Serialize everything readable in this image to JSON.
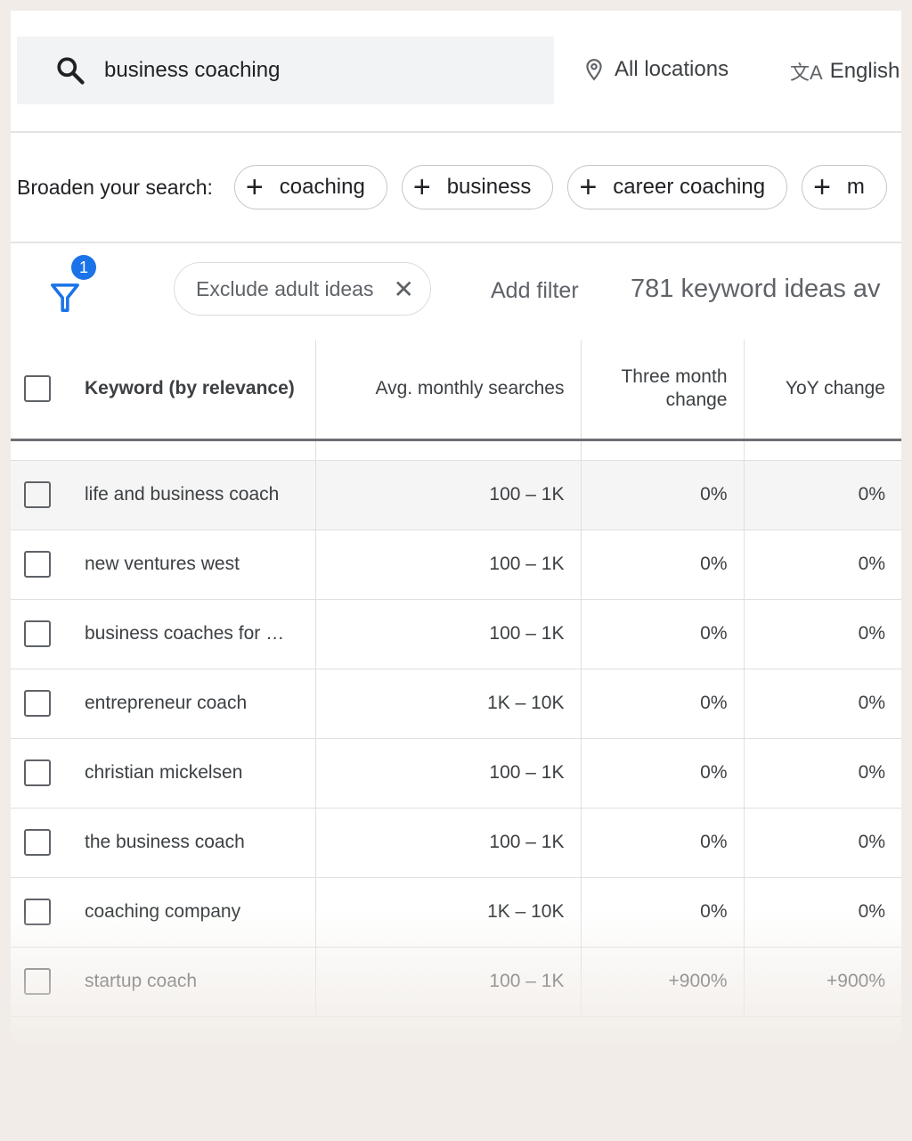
{
  "search": {
    "query": "business coaching",
    "location": "All locations",
    "language": "English"
  },
  "broaden": {
    "label": "Broaden your search:",
    "chips": [
      "coaching",
      "business",
      "career coaching",
      "m"
    ]
  },
  "filters": {
    "badge_count": "1",
    "active_filter": "Exclude adult ideas",
    "add_filter": "Add filter",
    "result_count": "781 keyword ideas av"
  },
  "table": {
    "headers": [
      "Keyword (by relevance)",
      "Avg. monthly searches",
      "Three month change",
      "YoY change"
    ],
    "rows": [
      {
        "keyword": "life and business coach",
        "searches": "100 – 1K",
        "three_month": "0%",
        "yoy": "0%"
      },
      {
        "keyword": "new ventures west",
        "searches": "100 – 1K",
        "three_month": "0%",
        "yoy": "0%"
      },
      {
        "keyword": "business coaches for …",
        "searches": "100 – 1K",
        "three_month": "0%",
        "yoy": "0%"
      },
      {
        "keyword": "entrepreneur coach",
        "searches": "1K – 10K",
        "three_month": "0%",
        "yoy": "0%"
      },
      {
        "keyword": "christian mickelsen",
        "searches": "100 – 1K",
        "three_month": "0%",
        "yoy": "0%"
      },
      {
        "keyword": "the business coach",
        "searches": "100 – 1K",
        "three_month": "0%",
        "yoy": "0%"
      },
      {
        "keyword": "coaching company",
        "searches": "1K – 10K",
        "three_month": "0%",
        "yoy": "0%"
      },
      {
        "keyword": "startup coach",
        "searches": "100 – 1K",
        "three_month": "+900%",
        "yoy": "+900%"
      }
    ]
  },
  "colors": {
    "accent": "#1a73e8",
    "background": "#f1ece7",
    "search_bg": "#f1f3f4"
  }
}
